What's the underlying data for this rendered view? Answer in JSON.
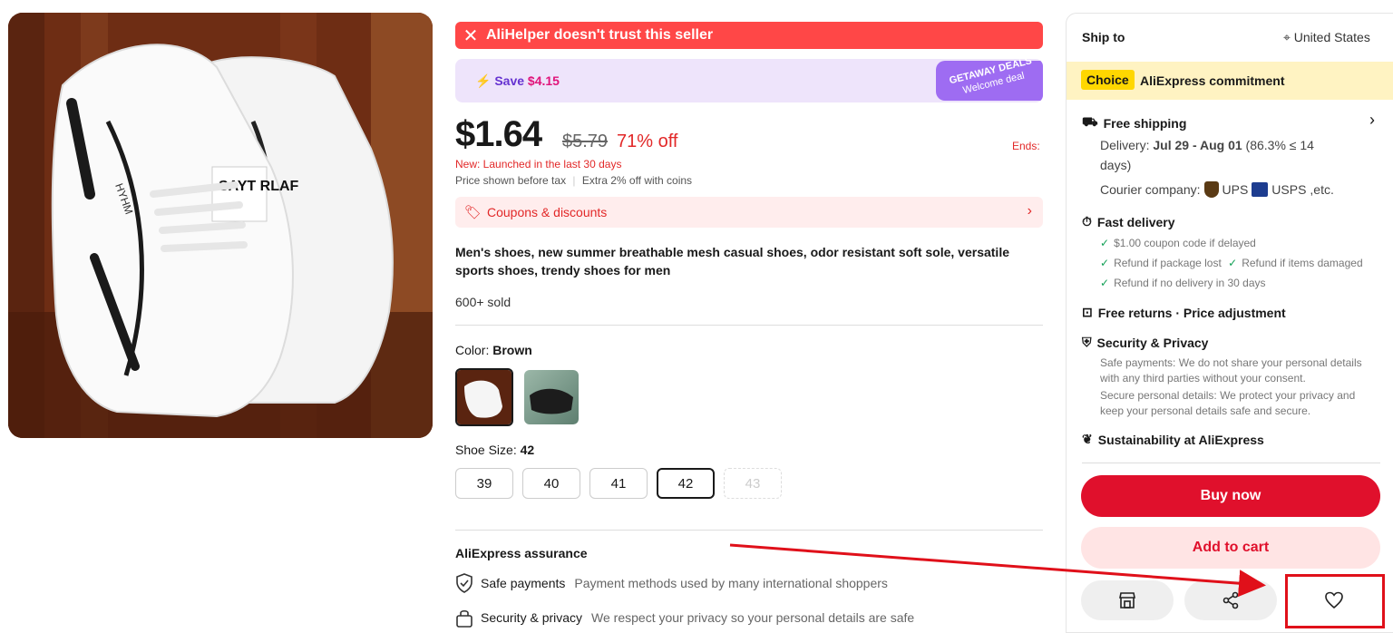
{
  "alert": {
    "text": "AliHelper doesn't trust this seller"
  },
  "promo": {
    "save_prefix": "Save",
    "save_amount": "$4.15",
    "deal_line1": "GETAWAY DEALS",
    "deal_line2": "Welcome deal"
  },
  "pricing": {
    "price": "$1.64",
    "old_price": "$5.79",
    "discount": "71% off",
    "ends_label": "Ends:",
    "new_label": "New: Launched in the last 30 days",
    "tax_note": "Price shown before tax",
    "coins_note": "Extra 2% off with coins"
  },
  "coupons": {
    "label": "Coupons & discounts"
  },
  "product": {
    "title": "Men's shoes, new summer breathable mesh casual shoes, odor resistant soft sole, versatile sports shoes, trendy shoes for men",
    "sold": "600+ sold",
    "shoe_text_1": "SAYT RLAF",
    "shoe_text_2": "HYHM"
  },
  "color": {
    "label": "Color:",
    "selected": "Brown"
  },
  "size": {
    "label": "Shoe Size:",
    "selected": "42",
    "options": [
      "39",
      "40",
      "41",
      "42",
      "43"
    ]
  },
  "assurance": {
    "title": "AliExpress assurance",
    "rows": [
      {
        "label": "Safe payments",
        "desc": "Payment methods used by many international shoppers"
      },
      {
        "label": "Security & privacy",
        "desc": "We respect your privacy so your personal details are safe"
      }
    ]
  },
  "ship": {
    "label": "Ship to",
    "country": "United States"
  },
  "choice": {
    "badge": "Choice",
    "text": "AliExpress commitment"
  },
  "shipping": {
    "title": "Free shipping",
    "delivery_prefix": "Delivery:",
    "delivery_dates": "Jul 29 - Aug 01",
    "delivery_rate": "(86.3% ≤ 14",
    "delivery_rate2": "days)",
    "courier_label": "Courier company:",
    "courier1": "UPS",
    "courier2": "USPS",
    "courier_etc": ",etc."
  },
  "fast_delivery": {
    "title": "Fast delivery",
    "items": [
      "$1.00 coupon code if delayed",
      "Refund if package lost",
      "Refund if items damaged",
      "Refund if no delivery in 30 days"
    ]
  },
  "returns": {
    "title": "Free returns · Price adjustment"
  },
  "security": {
    "title": "Security & Privacy",
    "text1a": "Safe payments: We do not share your personal details",
    "text1b": "with any third parties without your consent.",
    "text2a": "Secure personal details: We protect your privacy and",
    "text2b": "keep your personal details safe and secure."
  },
  "sustainability": {
    "title": "Sustainability at AliExpress"
  },
  "actions": {
    "buy_now": "Buy now",
    "add_to_cart": "Add to cart"
  },
  "colors": {
    "accent_red": "#e0102c",
    "alert_red": "#ff4747",
    "choice_yellow": "#ffd700",
    "promo_purple": "#9e6cf2"
  }
}
